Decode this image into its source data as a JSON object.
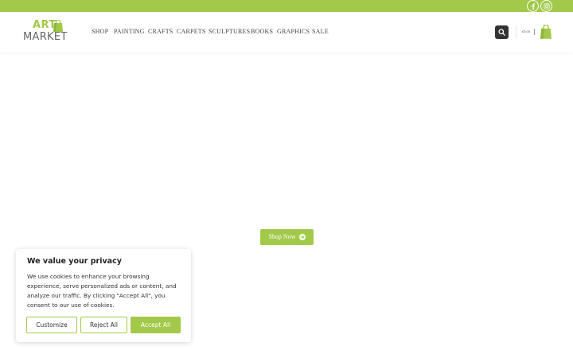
{
  "colors": {
    "accent": "#a3c94a",
    "dark": "#333333",
    "text": "#444444"
  },
  "topbar": {
    "social": [
      {
        "icon": "facebook-icon"
      },
      {
        "icon": "instagram-icon"
      }
    ]
  },
  "logo": {
    "line1": "ART",
    "line2": "MARKET",
    "icon": "shopping-bag-icon"
  },
  "nav": {
    "items": [
      "SHOP",
      "PAINTING",
      "CRAFTS",
      "CARPETS",
      "SCULPTURES",
      "BOOKS",
      "GRAPHICS",
      "SALE"
    ]
  },
  "header_actions": {
    "search_icon": "search-icon",
    "cart_total": "£0,00",
    "cart_icon": "shopping-bag-icon"
  },
  "hero": {
    "cta_label": "Shop Now",
    "cta_icon": "arrow-circle-right-icon"
  },
  "cookie_banner": {
    "title": "We value your privacy",
    "body": "We use cookies to enhance your browsing experience, serve personalized ads or content, and analyze our traffic. By clicking \"Accept All\", you consent to our use of cookies.",
    "customize_label": "Customize",
    "reject_label": "Reject All",
    "accept_label": "Accept All"
  }
}
